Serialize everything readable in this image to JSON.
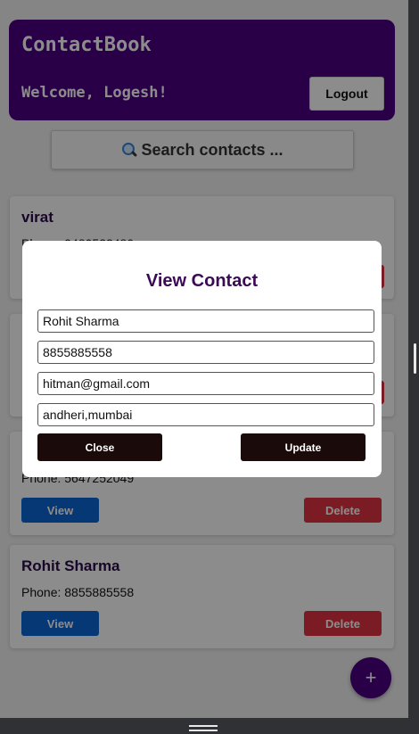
{
  "app": {
    "brand": "ContactBook",
    "welcome": "Welcome, Logesh!",
    "logout_label": "Logout"
  },
  "search": {
    "icon": "magnifier-icon",
    "label": "Search contacts  ..."
  },
  "contacts": [
    {
      "name": "virat",
      "phone": "Phone: 9480522480"
    },
    {
      "name": "",
      "phone": ""
    },
    {
      "name": "",
      "phone": "Phone: 5647252049"
    },
    {
      "name": "Rohit Sharma",
      "phone": "Phone: 8855885558"
    }
  ],
  "card_actions": {
    "view_label": "View",
    "delete_label": "Delete"
  },
  "fab": {
    "label": "+"
  },
  "modal": {
    "title": "View Contact",
    "name_value": "Rohit Sharma",
    "phone_value": "8855885558",
    "email_value": "hitman@gmail.com",
    "address_value": "andheri,mumbai",
    "close_label": "Close",
    "update_label": "Update"
  },
  "colors": {
    "primary": "#4b0082",
    "view": "#0b66d8",
    "delete": "#e03444",
    "modal_button": "#1a0a0a"
  }
}
